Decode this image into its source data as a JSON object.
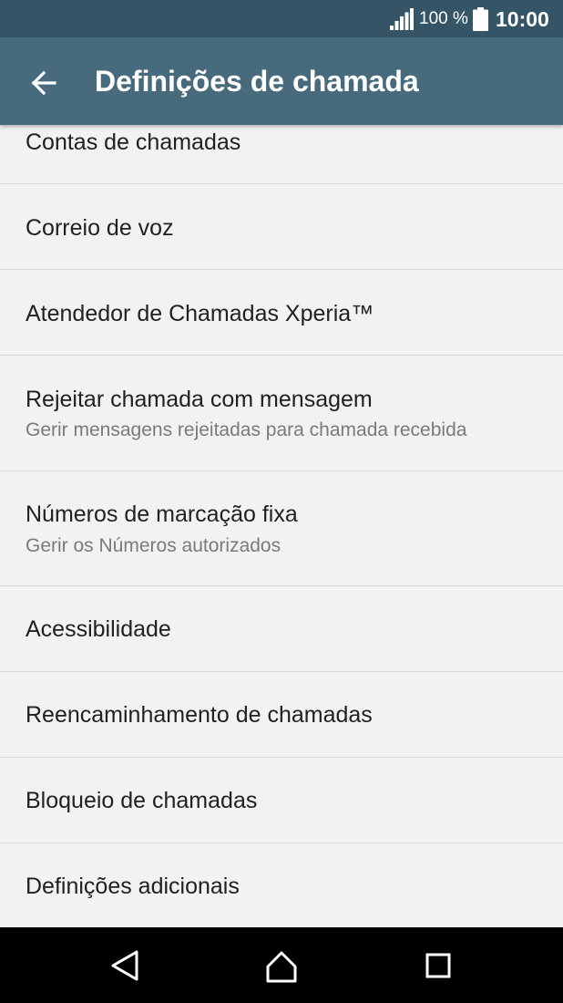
{
  "status_bar": {
    "battery_percent": "100 %",
    "time": "10:00",
    "signal_icon": "signal-icon",
    "battery_icon": "battery-icon"
  },
  "app_bar": {
    "back_icon": "arrow-back-icon",
    "title": "Definições de chamada"
  },
  "settings": {
    "items": [
      {
        "label": "Contas de chamadas",
        "subtitle": ""
      },
      {
        "label": "Correio de voz",
        "subtitle": ""
      },
      {
        "label": "Atendedor de Chamadas Xperia™",
        "subtitle": ""
      },
      {
        "label": "Rejeitar chamada com mensagem",
        "subtitle": "Gerir mensagens rejeitadas para chamada recebida"
      },
      {
        "label": "Números de marcação fixa",
        "subtitle": "Gerir os Números autorizados"
      },
      {
        "label": "Acessibilidade",
        "subtitle": ""
      },
      {
        "label": "Reencaminhamento de chamadas",
        "subtitle": ""
      },
      {
        "label": "Bloqueio de chamadas",
        "subtitle": ""
      },
      {
        "label": "Definições adicionais",
        "subtitle": ""
      }
    ]
  },
  "nav_bar": {
    "back_icon": "nav-back-icon",
    "home_icon": "nav-home-icon",
    "recents_icon": "nav-recents-icon"
  },
  "colors": {
    "status_bar": "#355566",
    "app_bar": "#476b7d",
    "background": "#f2f2f2",
    "divider": "#d6d6d6",
    "primary_text": "#212121",
    "secondary_text": "#7a7a7a",
    "nav_bar": "#000000"
  }
}
